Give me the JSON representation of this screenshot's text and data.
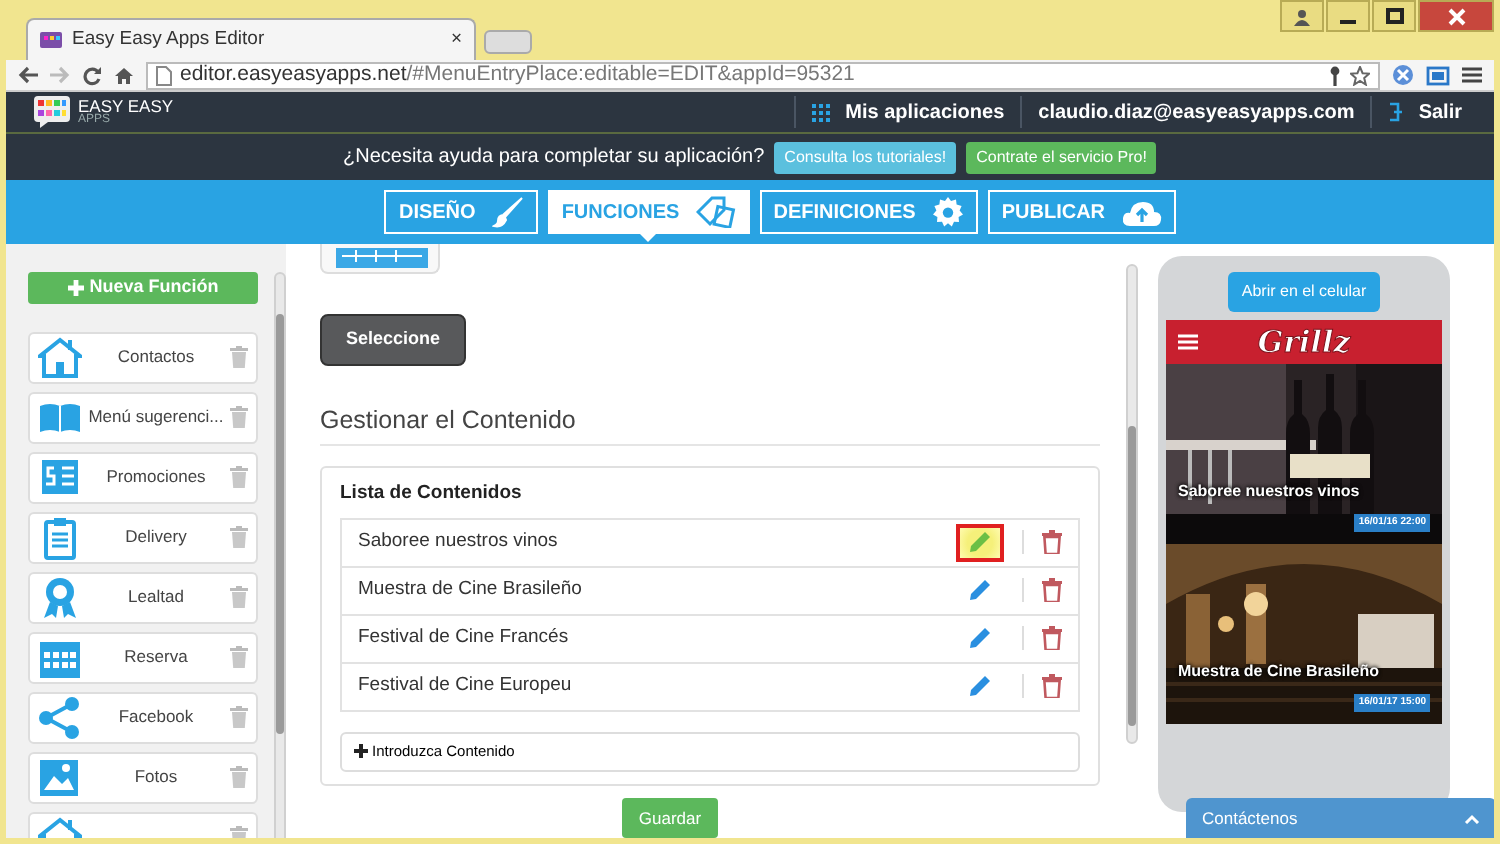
{
  "browser": {
    "tab_title": "Easy Easy Apps Editor",
    "tab_close": "×",
    "address": {
      "host": "editor.easyeasyapps.net",
      "path": "/#MenuEntryPlace:editable=EDIT&appId=95321"
    }
  },
  "header": {
    "logo": {
      "line1": "EASY EASY",
      "line2": "APPS"
    },
    "links": [
      {
        "kind": "apps",
        "label": "Mis aplicaciones"
      },
      {
        "kind": "user",
        "label": "claudio.diaz@easyeasyapps.com"
      },
      {
        "kind": "logout",
        "label": "Salir"
      }
    ]
  },
  "help_bar": {
    "text": "¿Necesita ayuda para completar su aplicación?",
    "buttons": [
      {
        "kind": "info",
        "label": "Consulta los tutoriales!"
      },
      {
        "kind": "success",
        "label": "Contrate el servicio Pro!"
      }
    ]
  },
  "main_tabs": [
    {
      "label": "DISEÑO",
      "selected": false
    },
    {
      "label": "FUNCIONES",
      "selected": true
    },
    {
      "label": "DEFINICIONES",
      "selected": false
    },
    {
      "label": "PUBLICAR",
      "selected": false
    }
  ],
  "sidebar": {
    "new_button": "Nueva Función",
    "items": [
      {
        "label": "Contactos"
      },
      {
        "label": "Menú sugerenci..."
      },
      {
        "label": "Promociones"
      },
      {
        "label": "Delivery"
      },
      {
        "label": "Lealtad"
      },
      {
        "label": "Reserva"
      },
      {
        "label": "Facebook"
      },
      {
        "label": "Fotos"
      }
    ]
  },
  "main": {
    "select_button": "Seleccione",
    "section_title": "Gestionar el Contenido",
    "panel_title": "Lista de Contenidos",
    "rows": [
      {
        "title": "Saboree nuestros vinos",
        "highlighted": true
      },
      {
        "title": "Muestra de Cine Brasileño",
        "highlighted": false
      },
      {
        "title": "Festival de Cine Francés",
        "highlighted": false
      },
      {
        "title": "Festival de Cine Europeu",
        "highlighted": false
      }
    ],
    "add_button": "Introduzca Contenido",
    "save_button": "Guardar"
  },
  "preview": {
    "open_button": "Abrir en el celular",
    "brand": "Grillz",
    "cards": [
      {
        "title": "Saboree nuestros vinos",
        "date": "16/01/16 22:00"
      },
      {
        "title": "Muestra de Cine Brasileño",
        "date": "16/01/17 15:00"
      }
    ],
    "contact_tab": "Contáctenos"
  }
}
